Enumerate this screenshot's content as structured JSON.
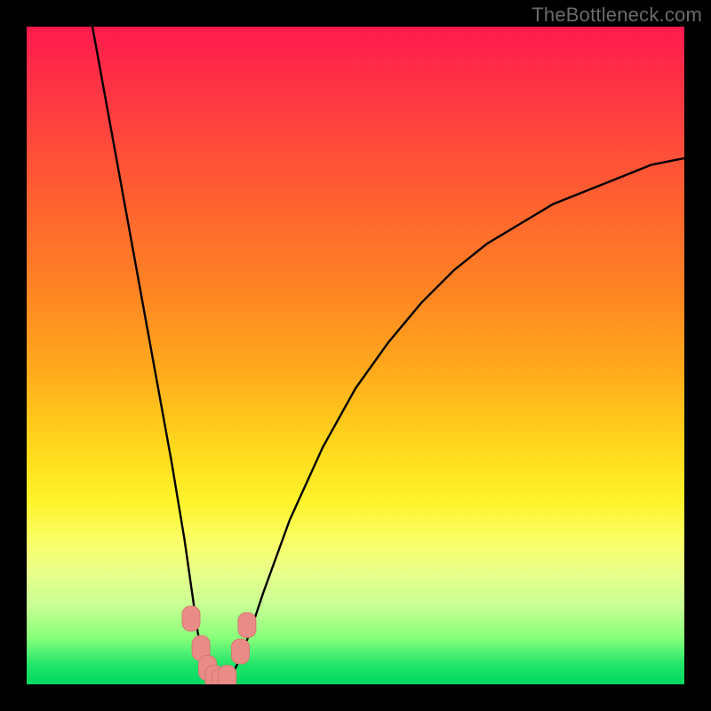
{
  "watermark": "TheBottleneck.com",
  "colors": {
    "frame": "#000000",
    "curve_stroke": "#000000",
    "marker_fill": "#e98b86",
    "marker_stroke": "#d87873",
    "gradient_top": "#ff1a4d",
    "gradient_bottom": "#00d860"
  },
  "chart_data": {
    "type": "line",
    "title": "",
    "xlabel": "",
    "ylabel": "",
    "xlim": [
      0,
      100
    ],
    "ylim": [
      0,
      100
    ],
    "grid": false,
    "legend": null,
    "note": "Bottleneck-style V curve. x = relative hardware balance (arbitrary 0–100), y = bottleneck percentage (0 = no bottleneck, 100 = full bottleneck). Values estimated from pixel positions.",
    "series": [
      {
        "name": "bottleneck_curve",
        "x": [
          10,
          12,
          14,
          16,
          18,
          20,
          22,
          24,
          25,
          26,
          27,
          28,
          29,
          30,
          31,
          32,
          34,
          36,
          40,
          45,
          50,
          55,
          60,
          65,
          70,
          75,
          80,
          85,
          90,
          95,
          100
        ],
        "y": [
          100,
          89,
          78,
          67,
          56,
          45,
          34,
          22,
          15,
          8,
          3,
          1,
          0,
          0,
          1,
          3,
          8,
          14,
          25,
          36,
          45,
          52,
          58,
          63,
          67,
          70,
          73,
          75,
          77,
          79,
          80
        ]
      }
    ],
    "markers": {
      "name": "highlight_points",
      "x": [
        25.0,
        26.5,
        27.5,
        28.5,
        29.5,
        30.5,
        32.5,
        33.5
      ],
      "y": [
        10.0,
        5.5,
        2.5,
        1.0,
        0.5,
        1.0,
        5.0,
        9.0
      ]
    }
  }
}
